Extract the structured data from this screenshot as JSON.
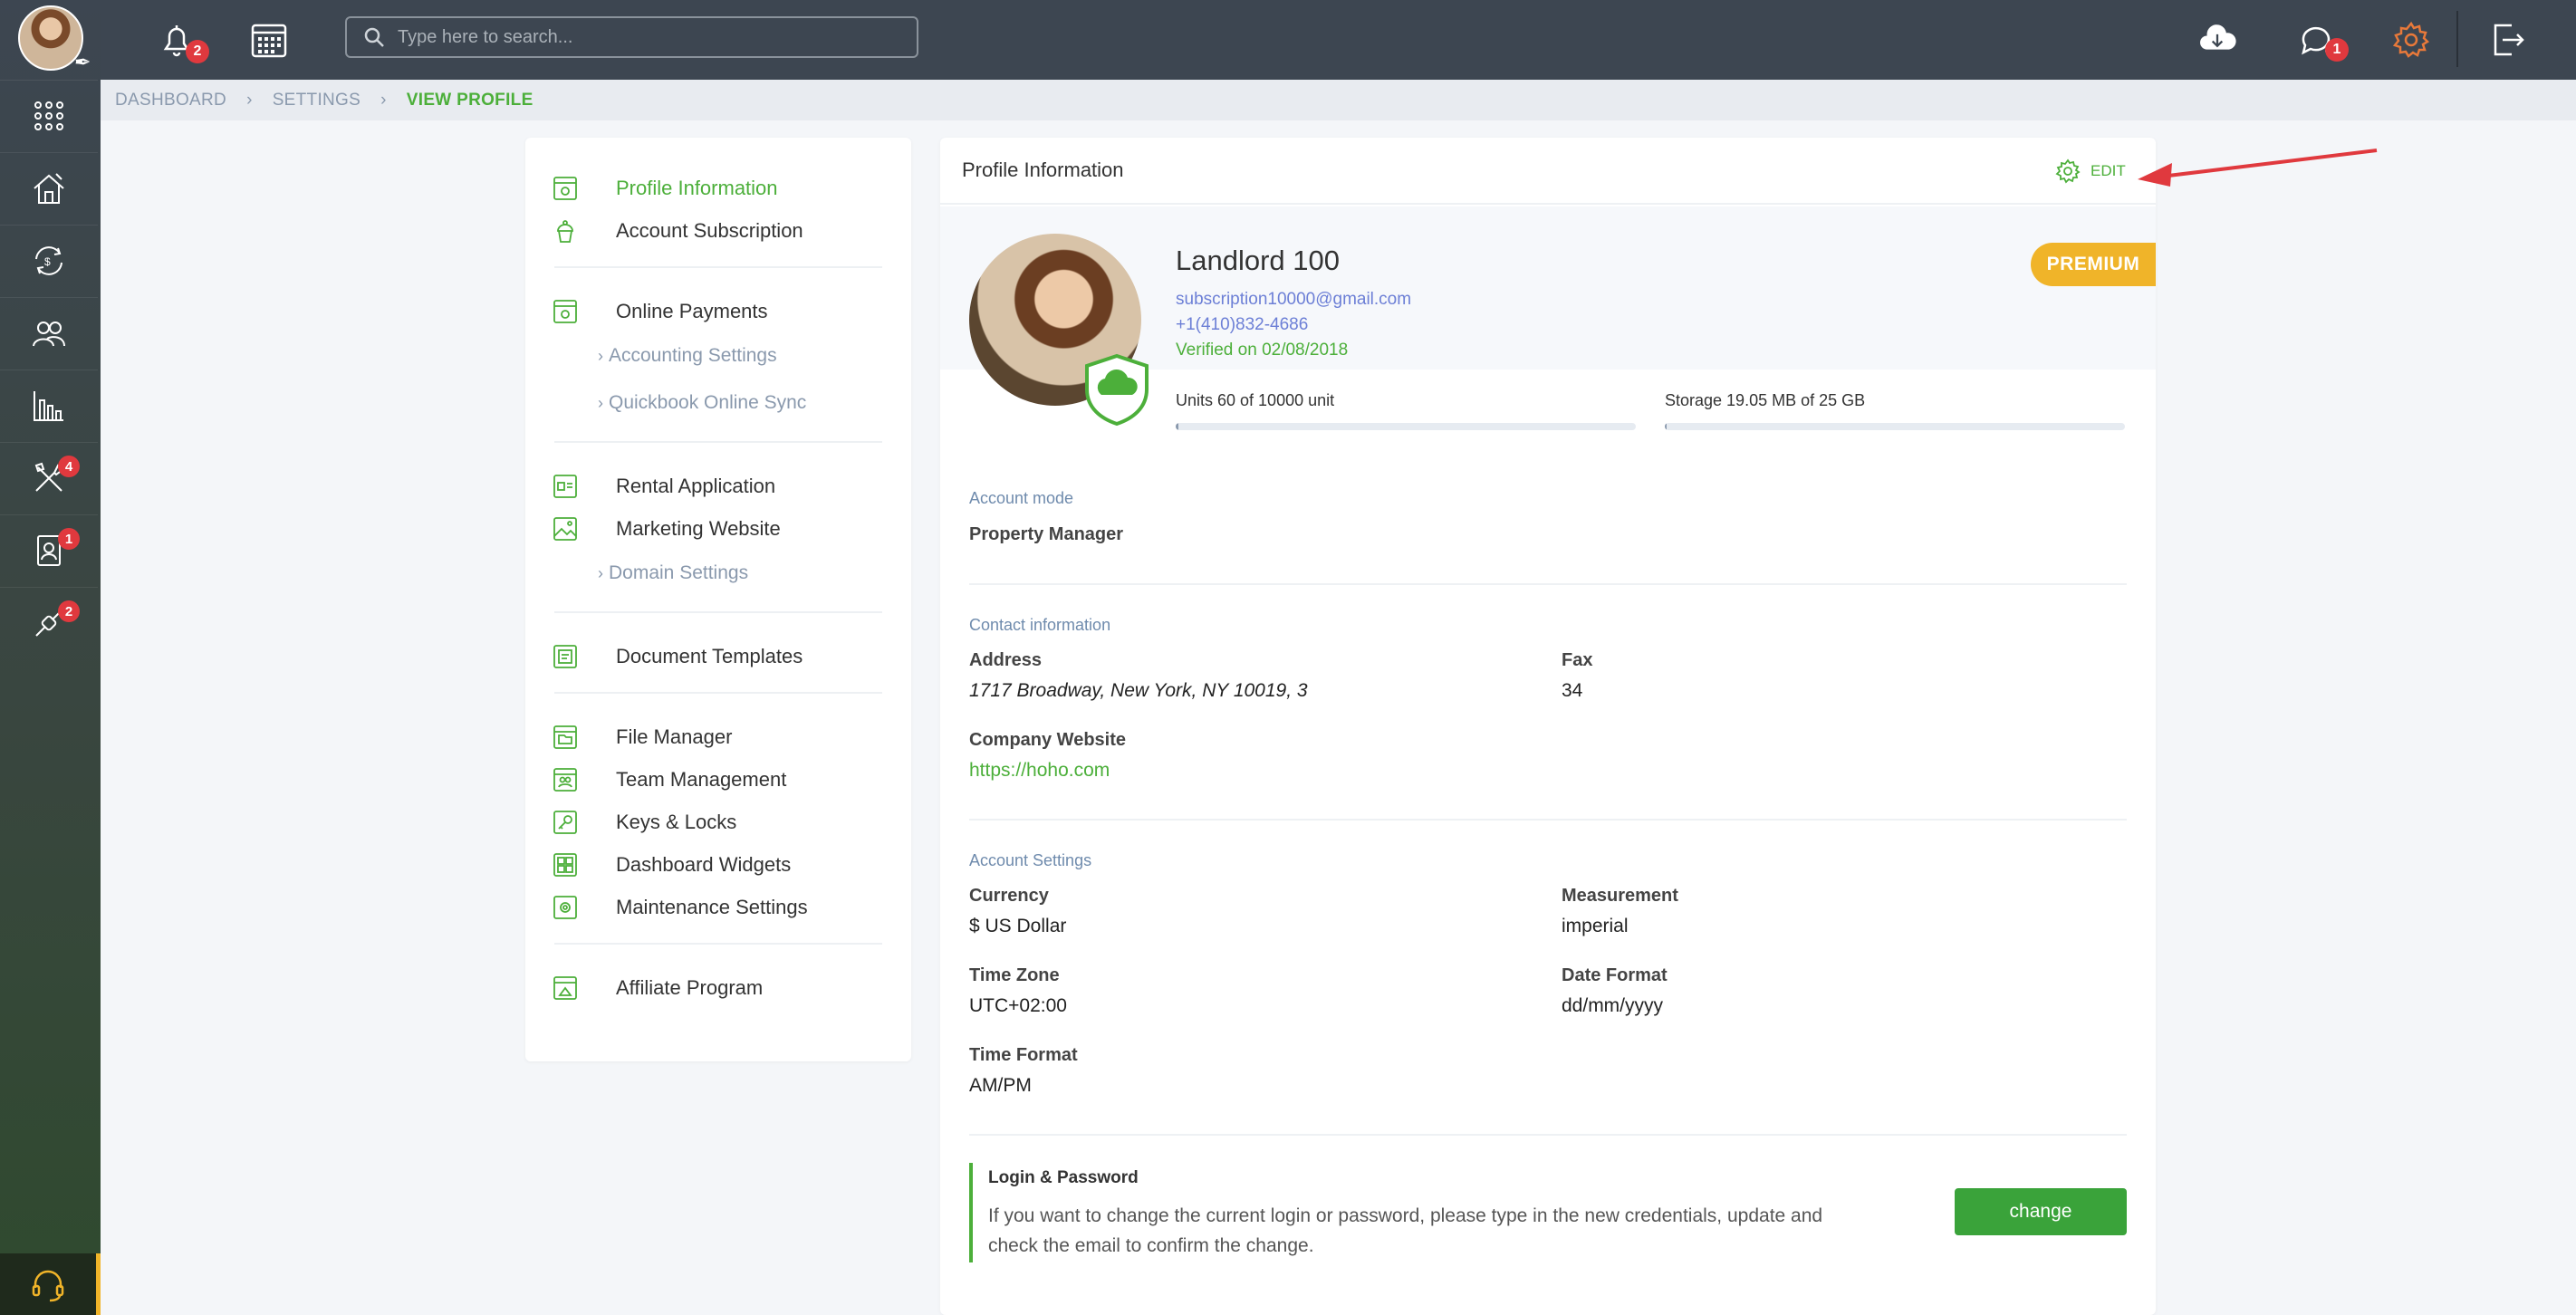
{
  "topbar": {
    "search_placeholder": "Type here to search...",
    "notifications_count": "2",
    "messages_count": "1"
  },
  "sidebar": {
    "items": [
      {
        "icon": "apps-grid-icon"
      },
      {
        "icon": "house-icon"
      },
      {
        "icon": "money-exchange-icon"
      },
      {
        "icon": "users-icon"
      },
      {
        "icon": "bar-chart-icon"
      },
      {
        "icon": "tools-icon",
        "badge": "4"
      },
      {
        "icon": "contact-card-icon",
        "badge": "1"
      },
      {
        "icon": "link-icon",
        "badge": "2"
      }
    ]
  },
  "breadcrumb": {
    "items": [
      "DASHBOARD",
      "SETTINGS",
      "VIEW PROFILE"
    ]
  },
  "menu": {
    "profile_information": "Profile Information",
    "account_subscription": "Account Subscription",
    "online_payments": "Online Payments",
    "accounting_settings": "Accounting Settings",
    "quickbook_online_sync": "Quickbook Online Sync",
    "rental_application": "Rental Application",
    "marketing_website": "Marketing Website",
    "domain_settings": "Domain Settings",
    "document_templates": "Document Templates",
    "file_manager": "File Manager",
    "team_management": "Team Management",
    "keys_locks": "Keys & Locks",
    "dashboard_widgets": "Dashboard Widgets",
    "maintenance_settings": "Maintenance Settings",
    "affiliate_program": "Affiliate Program"
  },
  "profile": {
    "header": "Profile Information",
    "edit_label": "EDIT",
    "name": "Landlord 100",
    "email": "subscription10000@gmail.com",
    "phone": "+1(410)832-4686",
    "verified": "Verified on 02/08/2018",
    "plan": "PREMIUM",
    "units_label": "Units 60 of 10000 unit",
    "units_fraction": 0.006,
    "storage_label": "Storage 19.05 MB of 25 GB",
    "storage_fraction": 0.0008,
    "account_mode_title": "Account mode",
    "account_mode_value": "Property Manager",
    "contact_title": "Contact information",
    "address_label": "Address",
    "address_value": "1717 Broadway, New York, NY 10019, 3",
    "fax_label": "Fax",
    "fax_value": "34",
    "website_label": "Company Website",
    "website_value": "https://hoho.com",
    "account_settings_title": "Account Settings",
    "currency_label": "Currency",
    "currency_value": "$ US Dollar",
    "measurement_label": "Measurement",
    "measurement_value": "imperial",
    "timezone_label": "Time Zone",
    "timezone_value": "UTC+02:00",
    "date_format_label": "Date Format",
    "date_format_value": "dd/mm/yyyy",
    "time_format_label": "Time Format",
    "time_format_value": "AM/PM",
    "login_title": "Login & Password",
    "login_desc": "If you want to change the current login or password, please type in the new credentials, update and check the email to confirm the change.",
    "change_label": "change"
  },
  "colors": {
    "accent_green": "#4caf3a",
    "premium_gold": "#f0b429",
    "badge_red": "#e0393e",
    "topbar": "#3d4651"
  }
}
